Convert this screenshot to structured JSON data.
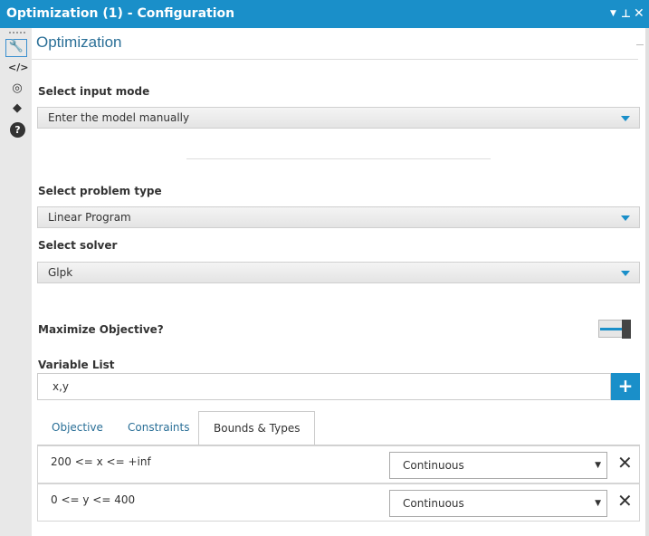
{
  "window": {
    "title": "Optimization (1) - Configuration"
  },
  "panel": {
    "title": "Optimization"
  },
  "input_mode": {
    "label": "Select input mode",
    "value": "Enter the model manually"
  },
  "problem_type": {
    "label": "Select problem type",
    "value": "Linear Program"
  },
  "solver": {
    "label": "Select solver",
    "value": "Glpk"
  },
  "maximize": {
    "label": "Maximize Objective?",
    "on": false
  },
  "variables": {
    "label": "Variable List",
    "value": "x,y"
  },
  "tabs": [
    {
      "label": "Objective"
    },
    {
      "label": "Constraints"
    },
    {
      "label": "Bounds & Types",
      "active": true
    }
  ],
  "bounds": [
    {
      "expr": "200 <= x <= +inf",
      "type": "Continuous"
    },
    {
      "expr": "0 <= y <= 400",
      "type": "Continuous"
    }
  ],
  "accent": "#1a8fc9"
}
